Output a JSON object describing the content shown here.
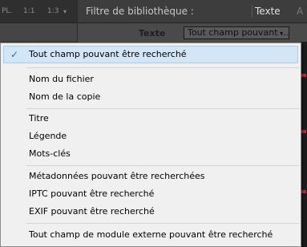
{
  "zoom_bar": {
    "items": [
      "PL.",
      "1:1",
      "1:3"
    ],
    "arrow": "▾"
  },
  "filter_bar": {
    "title": "Filtre de bibliothèque :",
    "active_tab": "Texte",
    "next_tab_fragment": "A"
  },
  "text_filter": {
    "label": "Texte",
    "selected_value": "Tout champ pouvant ...",
    "arrow": "▾"
  },
  "menu": {
    "check_glyph": "✓",
    "items": [
      {
        "label": "Tout champ pouvant être recherché",
        "checked": true
      },
      {
        "label": "Nom du fichier",
        "checked": false
      },
      {
        "label": "Nom de la copie",
        "checked": false
      },
      {
        "label": "Titre",
        "checked": false
      },
      {
        "label": "Légende",
        "checked": false
      },
      {
        "label": "Mots-clés",
        "checked": false
      },
      {
        "label": "Métadonnées pouvant être recherchées",
        "checked": false
      },
      {
        "label": "IPTC pouvant être recherché",
        "checked": false
      },
      {
        "label": "EXIF pouvant être recherché",
        "checked": false
      },
      {
        "label": "Tout champ de module externe pouvant être recherché",
        "checked": false
      }
    ]
  },
  "colors": {
    "selection_bg": "#d2e6f7",
    "selection_border": "#a9cde9",
    "checkmark": "#1f6fb6",
    "menu_bg": "#f0f0f0",
    "app_dark": "#2b2b2b"
  }
}
